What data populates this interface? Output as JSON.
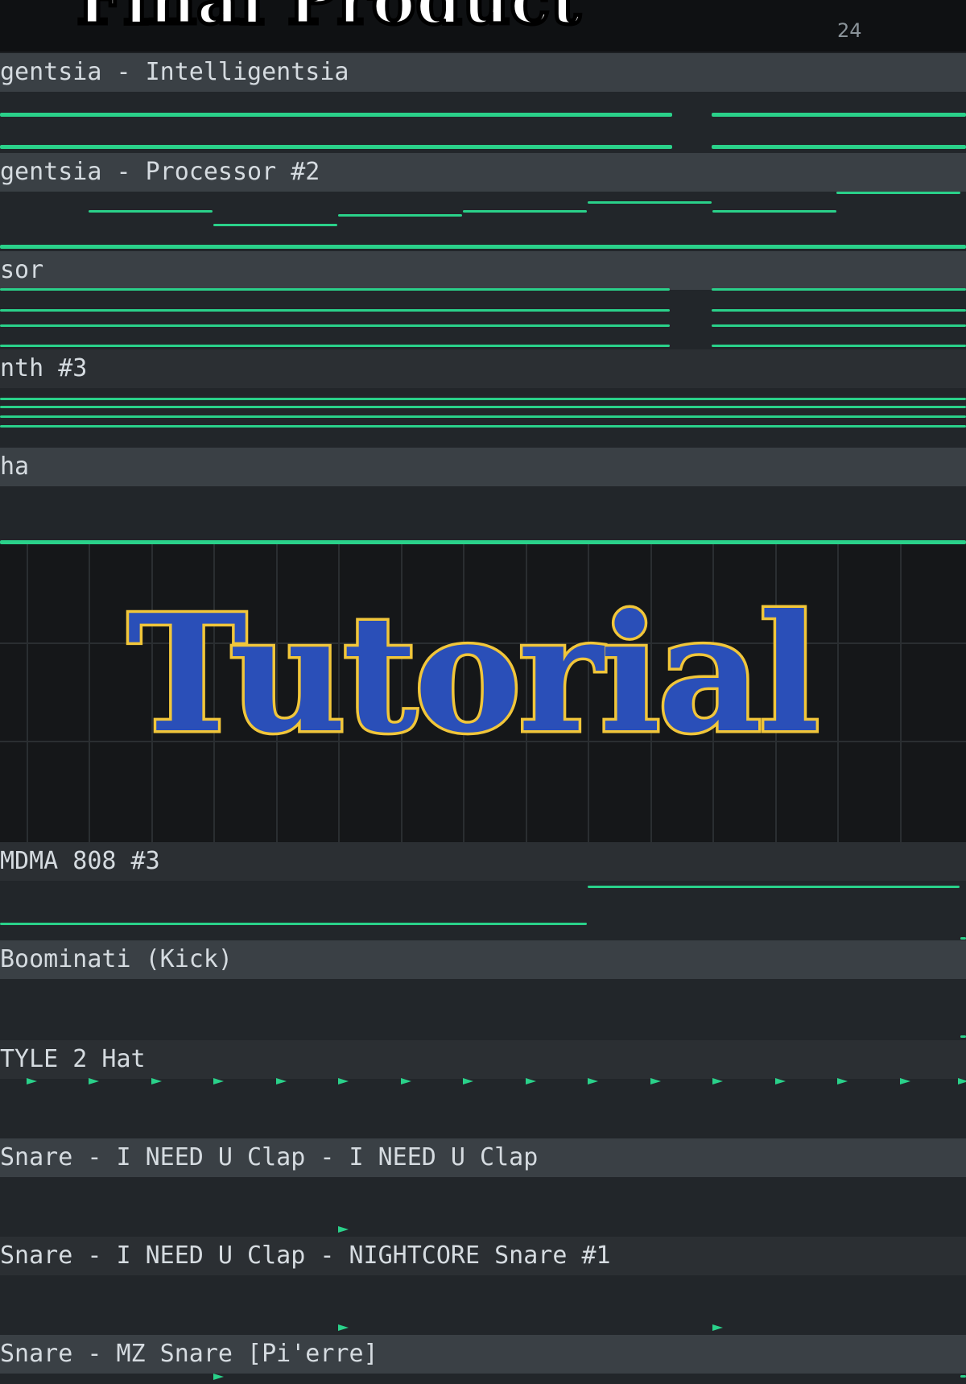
{
  "overlay": {
    "title": "Final Product",
    "center": "Tutorial"
  },
  "timeline": {
    "bar_number": "24"
  },
  "tracks": [
    {
      "label": "gentsia - Intelligentsia"
    },
    {
      "label": "gentsia - Processor #2"
    },
    {
      "label": "sor"
    },
    {
      "label": "nth #3"
    },
    {
      "label": "ha"
    },
    {
      "label": "MDMA 808 #3"
    },
    {
      "label": "Boominati (Kick)"
    },
    {
      "label": "TYLE 2 Hat"
    },
    {
      "label": "Snare - I NEED U Clap - I NEED U Clap"
    },
    {
      "label": "Snare - I NEED U Clap - NIGHTCORE Snare #1"
    },
    {
      "label": "Snare - MZ Snare [Pi'erre]"
    }
  ],
  "colors": {
    "note": "#2ad18a",
    "header": "#3a4045",
    "background": "#1c1f22",
    "tutorial_fill": "#2a4fb8",
    "tutorial_outline": "#f1c63a"
  }
}
